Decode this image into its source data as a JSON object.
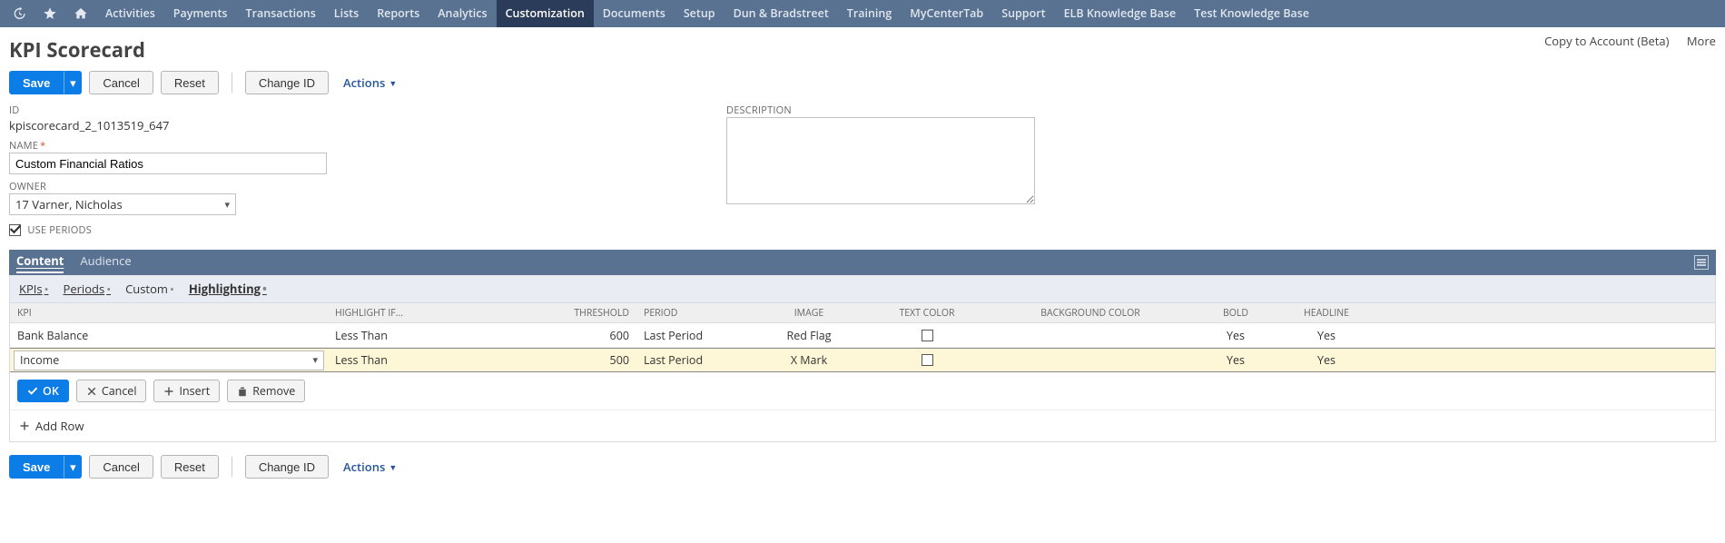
{
  "topnav": {
    "items": [
      "Activities",
      "Payments",
      "Transactions",
      "Lists",
      "Reports",
      "Analytics",
      "Customization",
      "Documents",
      "Setup",
      "Dun & Bradstreet",
      "Training",
      "MyCenterTab",
      "Support",
      "ELB Knowledge Base",
      "Test Knowledge Base"
    ],
    "active_index": 6
  },
  "page": {
    "title": "KPI Scorecard",
    "head_links": {
      "copy": "Copy to Account (Beta)",
      "more": "More"
    }
  },
  "buttons": {
    "save": "Save",
    "cancel": "Cancel",
    "reset": "Reset",
    "change_id": "Change ID",
    "actions": "Actions"
  },
  "form": {
    "id_label": "ID",
    "id_value": "kpiscorecard_2_1013519_647",
    "name_label": "NAME",
    "name_value": "Custom Financial Ratios",
    "owner_label": "OWNER",
    "owner_value": "17 Varner, Nicholas",
    "use_periods_label": "USE PERIODS",
    "use_periods_checked": true,
    "description_label": "DESCRIPTION",
    "description_value": ""
  },
  "tabs": {
    "items": [
      "Content",
      "Audience"
    ],
    "active_index": 0
  },
  "subtabs": {
    "items": [
      "KPIs",
      "Periods",
      "Custom",
      "Highlighting"
    ],
    "active_index": 3
  },
  "grid": {
    "headers": {
      "kpi": "KPI",
      "highlight_if": "HIGHLIGHT IF...",
      "threshold": "THRESHOLD",
      "period": "PERIOD",
      "image": "IMAGE",
      "text_color": "TEXT COLOR",
      "background_color": "BACKGROUND COLOR",
      "bold": "BOLD",
      "headline": "HEADLINE"
    },
    "rows": [
      {
        "kpi": "Bank Balance",
        "highlight_if": "Less Than",
        "threshold": "600",
        "period": "Last Period",
        "image": "Red Flag",
        "text_color_checked": false,
        "background_color": "",
        "bold": "Yes",
        "headline": "Yes"
      },
      {
        "kpi": "Income",
        "highlight_if": "Less Than",
        "threshold": "500",
        "period": "Last Period",
        "image": "X Mark",
        "text_color_checked": false,
        "background_color": "",
        "bold": "Yes",
        "headline": "Yes"
      }
    ],
    "row_buttons": {
      "ok": "OK",
      "cancel": "Cancel",
      "insert": "Insert",
      "remove": "Remove"
    },
    "add_row": "Add Row"
  }
}
